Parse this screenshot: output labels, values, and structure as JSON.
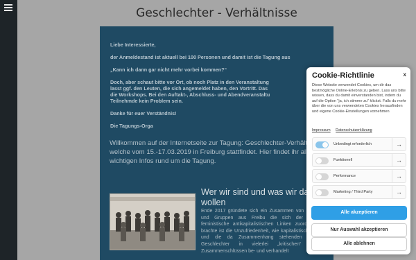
{
  "site": {
    "title": "Geschlechter - Verhältnisse"
  },
  "notice": {
    "greeting": "Liebe Interessierte,",
    "line1": "der Anmeldestand ist aktuell bei 100 Personen und damit ist die Tagung aus",
    "question": "„Kann ich dann gar nicht mehr vorbei kommen?“",
    "line2a": "Doch, aber schaut bitte vor Ort, ob noch Platz in den Veranstaltung",
    "line2b": "lasst ggf. den Leuten, die sich angemeldet haben, den Vortritt. Das",
    "line2c": "die Workshops. Bei den Auftakt-, Abschluss- und Abendveranstaltu",
    "line2d": "Teilnehmde kein Problem sein.",
    "thanks": "Danke für euer Verständnis!",
    "signature": "Die Tagungs-Orga"
  },
  "welcome": "Willkommen auf der Internetseite zur Tagung: Geschlechter-Verhältnisse -, welche vom 15.-17.03.2019 in Freiburg stattfindet. Hier findet ihr alle wichtigen Infos rund um die Tagung.",
  "teaser": {
    "title": "Wer wir sind und was wir damit wollen",
    "text": "Ende 2017 gründete sich ein Zusammen von Einzelpersonen und Gruppen aus Freibu die sich der antinationalen, feministische antikapitalistischen Linken zuordnen. Was sie brachte ist die Unzufriedenheit, wie kapitalistische Gesellschaft und die da Zusammenhang stehenden Anforderungen Geschlechter in vielerlei „kritischen“ Bewe und Zusammenschlüssen be- und verhandelt"
  },
  "cookie": {
    "title": "Cookie-Richtlinie",
    "close": "x",
    "body": "Diese Website verwendet Cookies, um dir das bestmögliche Online-Erlebnis zu geben. Lass uns bitte wissen, dass du damit einverstanden bist, indem du auf die Option \"ja, ich stimme zu\" klickst. Falls du mehr über die von uns verwendeten Cookies herausfinden und eigene Cookie-Einstellungen vornehmen",
    "link_impressum": "Impressum",
    "link_privacy": "Datenschutzerklärung",
    "categories": [
      {
        "label": "Unbedingt erforderlich",
        "enabled": true
      },
      {
        "label": "Funktionell",
        "enabled": false
      },
      {
        "label": "Performance",
        "enabled": false
      },
      {
        "label": "Marketing / Third Party",
        "enabled": false
      }
    ],
    "arrow": "→",
    "accept_all": "Alle akzeptieren",
    "accept_selection": "Nur Auswahl akzeptieren",
    "reject_all": "Alle ablehnen"
  },
  "colors": {
    "accent": "#2f9fe6",
    "content_bg": "#1f4a63",
    "sidebar": "#1e2428"
  },
  "icons": {
    "menu": "hamburger-icon",
    "arrow": "arrow-right-icon",
    "close": "close-icon"
  }
}
